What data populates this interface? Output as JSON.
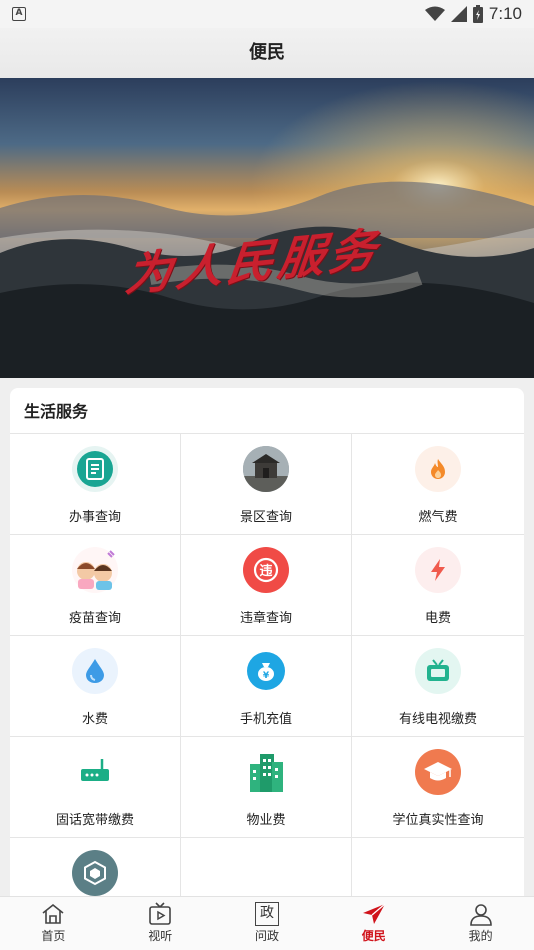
{
  "status": {
    "time": "7:10",
    "left_badge": "A"
  },
  "header": {
    "title": "便民"
  },
  "banner": {
    "headline": "为人民服务",
    "slide_count": 3,
    "active_index": 0
  },
  "section": {
    "title": "生活服务"
  },
  "services": [
    {
      "label": "办事查询",
      "icon": "document-icon",
      "bg": "#1aa896"
    },
    {
      "label": "景区查询",
      "icon": "scenic-photo-icon",
      "bg": "#6b6b6b"
    },
    {
      "label": "燃气费",
      "icon": "flame-icon",
      "bg": "#fdf0e8"
    },
    {
      "label": "疫苗查询",
      "icon": "vaccine-kids-icon",
      "bg": "#fff6f6"
    },
    {
      "label": "违章查询",
      "icon": "violation-icon",
      "bg": "#f04b46"
    },
    {
      "label": "电费",
      "icon": "lightning-icon",
      "bg": "#fdeeee"
    },
    {
      "label": "水费",
      "icon": "water-drop-icon",
      "bg": "#eaf3fd"
    },
    {
      "label": "手机充值",
      "icon": "money-bag-icon",
      "bg": "#1ea6e3"
    },
    {
      "label": "有线电视缴费",
      "icon": "tv-icon",
      "bg": "#e3f6f1"
    },
    {
      "label": "固话宽带缴费",
      "icon": "router-icon",
      "bg": "#ffffff"
    },
    {
      "label": "物业费",
      "icon": "building-icon",
      "bg": "#ffffff"
    },
    {
      "label": "学位真实性查询",
      "icon": "graduation-cap-icon",
      "bg": "#f07a4f"
    },
    {
      "label": "",
      "icon": "hexagon-icon",
      "bg": "#5b7f86"
    },
    {
      "label": "",
      "icon": "",
      "bg": "#ffffff"
    },
    {
      "label": "",
      "icon": "",
      "bg": "#ffffff"
    }
  ],
  "tabs": [
    {
      "label": "首页",
      "icon": "home-icon"
    },
    {
      "label": "视听",
      "icon": "video-icon"
    },
    {
      "label": "问政",
      "icon": "politics-icon",
      "glyph": "政"
    },
    {
      "label": "便民",
      "icon": "send-icon",
      "active": true
    },
    {
      "label": "我的",
      "icon": "user-icon"
    }
  ],
  "colors": {
    "accent": "#d0131b",
    "dot_active": "#e8472e"
  }
}
